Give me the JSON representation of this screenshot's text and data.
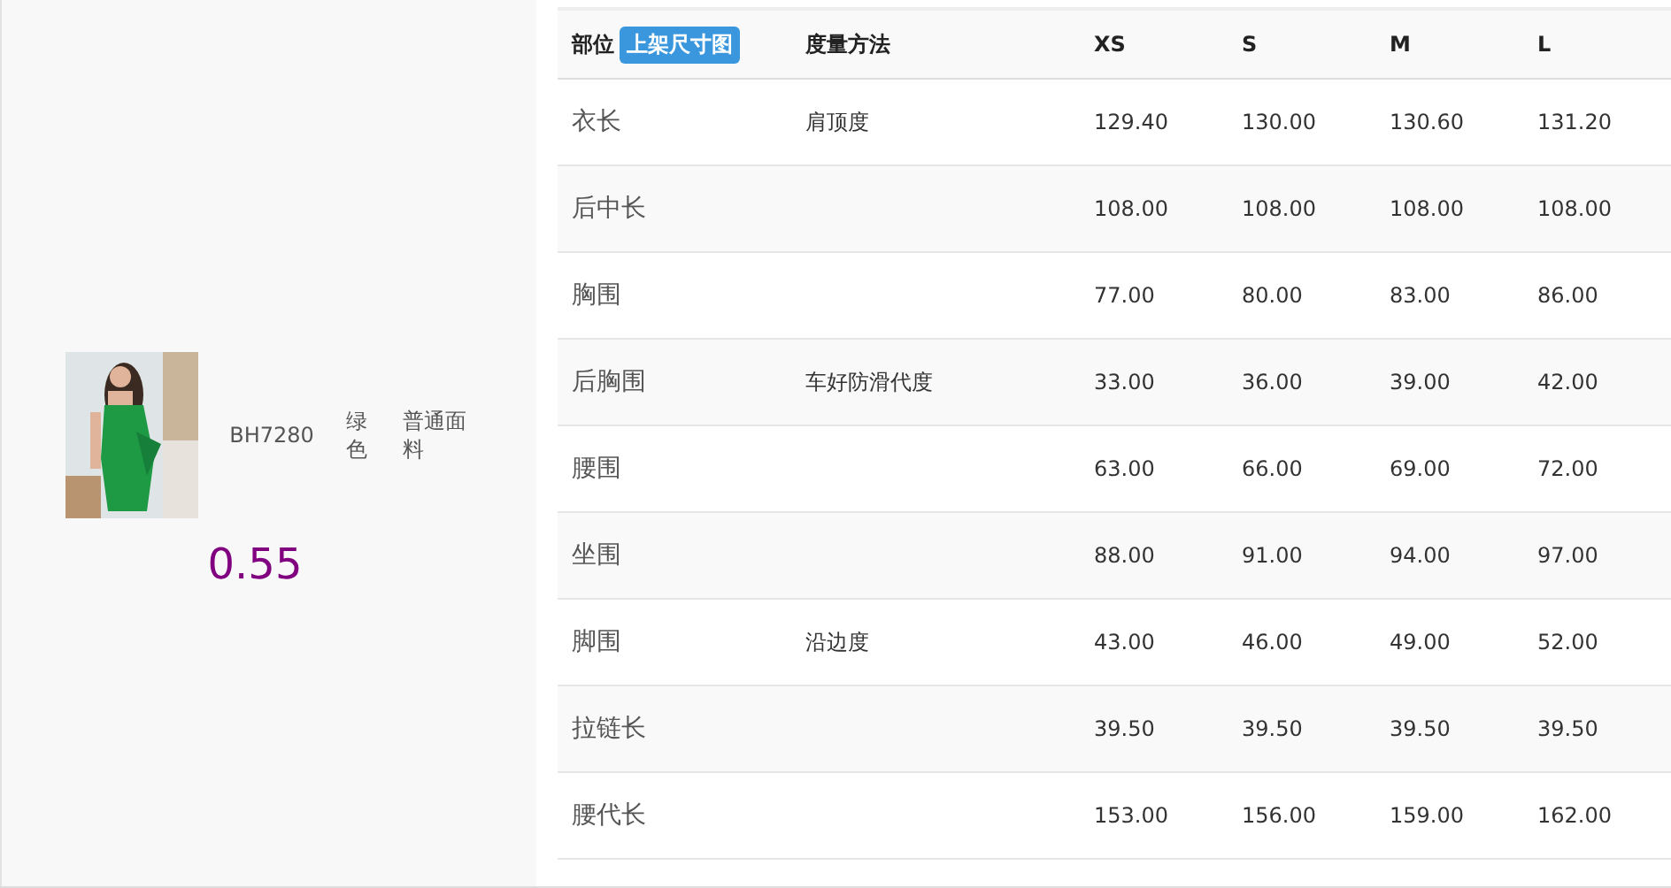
{
  "product": {
    "code": "BH7280",
    "color_name": "绿色",
    "fabric": "普通面料",
    "ratio": "0.55"
  },
  "table": {
    "columns": [
      "部位",
      "度量方法",
      "XS",
      "S",
      "M",
      "L"
    ],
    "header_button": "上架尺寸图",
    "rows": [
      {
        "part": "衣长",
        "method": "肩顶度",
        "values": [
          "129.40",
          "130.00",
          "130.60",
          "131.20"
        ]
      },
      {
        "part": "后中长",
        "values": [
          "108.00",
          "108.00",
          "108.00",
          "108.00"
        ]
      },
      {
        "part": "胸围",
        "values": [
          "77.00",
          "80.00",
          "83.00",
          "86.00"
        ]
      },
      {
        "part": "后胸围",
        "method": "车好防滑代度",
        "values": [
          "33.00",
          "36.00",
          "39.00",
          "42.00"
        ]
      },
      {
        "part": "腰围",
        "values": [
          "63.00",
          "66.00",
          "69.00",
          "72.00"
        ]
      },
      {
        "part": "坐围",
        "values": [
          "88.00",
          "91.00",
          "94.00",
          "97.00"
        ]
      },
      {
        "part": "脚围",
        "method": "沿边度",
        "values": [
          "43.00",
          "46.00",
          "49.00",
          "52.00"
        ]
      },
      {
        "part": "拉链长",
        "values": [
          "39.50",
          "39.50",
          "39.50",
          "39.50"
        ]
      },
      {
        "part": "腰代长",
        "values": [
          "153.00",
          "156.00",
          "159.00",
          "162.00"
        ]
      }
    ]
  }
}
